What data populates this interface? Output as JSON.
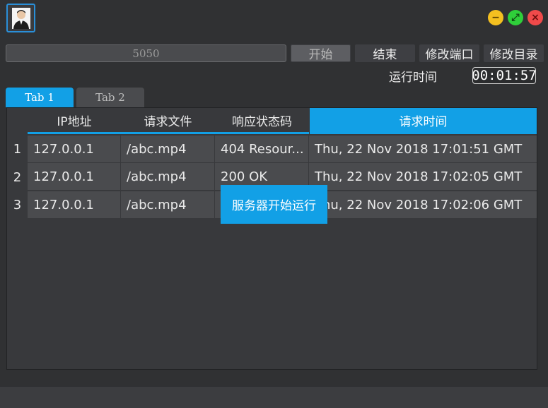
{
  "window": {
    "avatar_icon": "user-avatar-icon",
    "minimize_glyph": "−",
    "maximize_glyph": "⤢",
    "close_glyph": "×"
  },
  "toolbar": {
    "port_value": "5050",
    "start_label": "开始",
    "end_label": "结束",
    "change_port_label": "修改端口",
    "change_dir_label": "修改目录"
  },
  "runtime": {
    "label": "运行时间",
    "value": "00:01:57"
  },
  "tabs": [
    {
      "label": "Tab 1",
      "active": true
    },
    {
      "label": "Tab 2",
      "active": false
    }
  ],
  "table": {
    "headers": [
      "IP地址",
      "请求文件",
      "响应状态码",
      "请求时间"
    ],
    "rows": [
      {
        "num": "1",
        "ip": "127.0.0.1",
        "file": "/abc.mp4",
        "status": "404 Resour...",
        "time": "Thu, 22 Nov 2018 17:01:51 GMT"
      },
      {
        "num": "2",
        "ip": "127.0.0.1",
        "file": "/abc.mp4",
        "status": "200 OK",
        "time": "Thu, 22 Nov 2018 17:02:05 GMT"
      },
      {
        "num": "3",
        "ip": "127.0.0.1",
        "file": "/abc.mp4",
        "status": "",
        "time": "Thu, 22 Nov 2018 17:02:06 GMT"
      }
    ]
  },
  "toast": "服务器开始运行",
  "colors": {
    "accent": "#12a0e6",
    "background": "#303133",
    "minimize": "#f4c020",
    "maximize": "#2fcf3a",
    "close": "#f04a4a"
  }
}
